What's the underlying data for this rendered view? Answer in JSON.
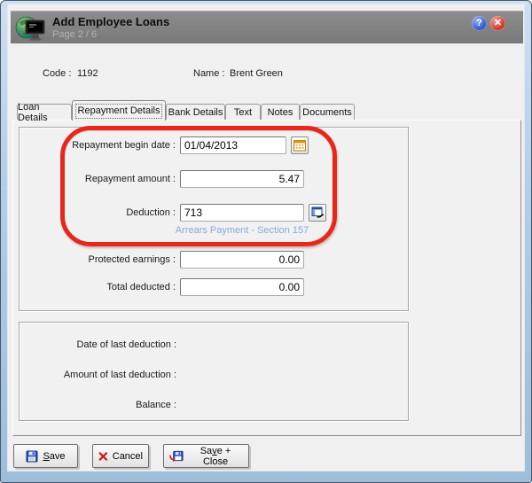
{
  "window": {
    "title": "Add Employee Loans",
    "subtitle": "Page 2 / 6",
    "help_glyph": "?",
    "close_glyph": "✕"
  },
  "header": {
    "code_label": "Code :",
    "code_value": "1192",
    "name_label": "Name :",
    "name_value": "Brent Green"
  },
  "tabs": [
    {
      "label": "Loan Details",
      "active": false
    },
    {
      "label": "Repayment Details",
      "active": true
    },
    {
      "label": "Bank Details",
      "active": false
    },
    {
      "label": "Text",
      "active": false
    },
    {
      "label": "Notes",
      "active": false
    },
    {
      "label": "Documents",
      "active": false
    }
  ],
  "form": {
    "repayment_begin_date": {
      "label": "Repayment begin date :",
      "value": "01/04/2013"
    },
    "repayment_amount": {
      "label": "Repayment amount :",
      "value": "5.47"
    },
    "deduction": {
      "label": "Deduction :",
      "value": "713",
      "description": "Arrears Payment - Section 157"
    },
    "protected_earnings": {
      "label": "Protected earnings :",
      "value": "0.00"
    },
    "total_deducted": {
      "label": "Total deducted :",
      "value": "0.00"
    }
  },
  "summary": {
    "date_of_last_deduction_label": "Date of last deduction :",
    "amount_of_last_deduction_label": "Amount of last deduction :",
    "balance_label": "Balance :"
  },
  "buttons": {
    "save": {
      "pre": "",
      "key": "S",
      "post": "ave"
    },
    "cancel_label": "Cancel",
    "save_close": {
      "pre": "Sa",
      "key": "v",
      "post": "e + Close"
    }
  },
  "colors": {
    "annotation": "#e8271c",
    "deduction_caption": "#86acd8",
    "titlebar": "#7d7d7d"
  }
}
